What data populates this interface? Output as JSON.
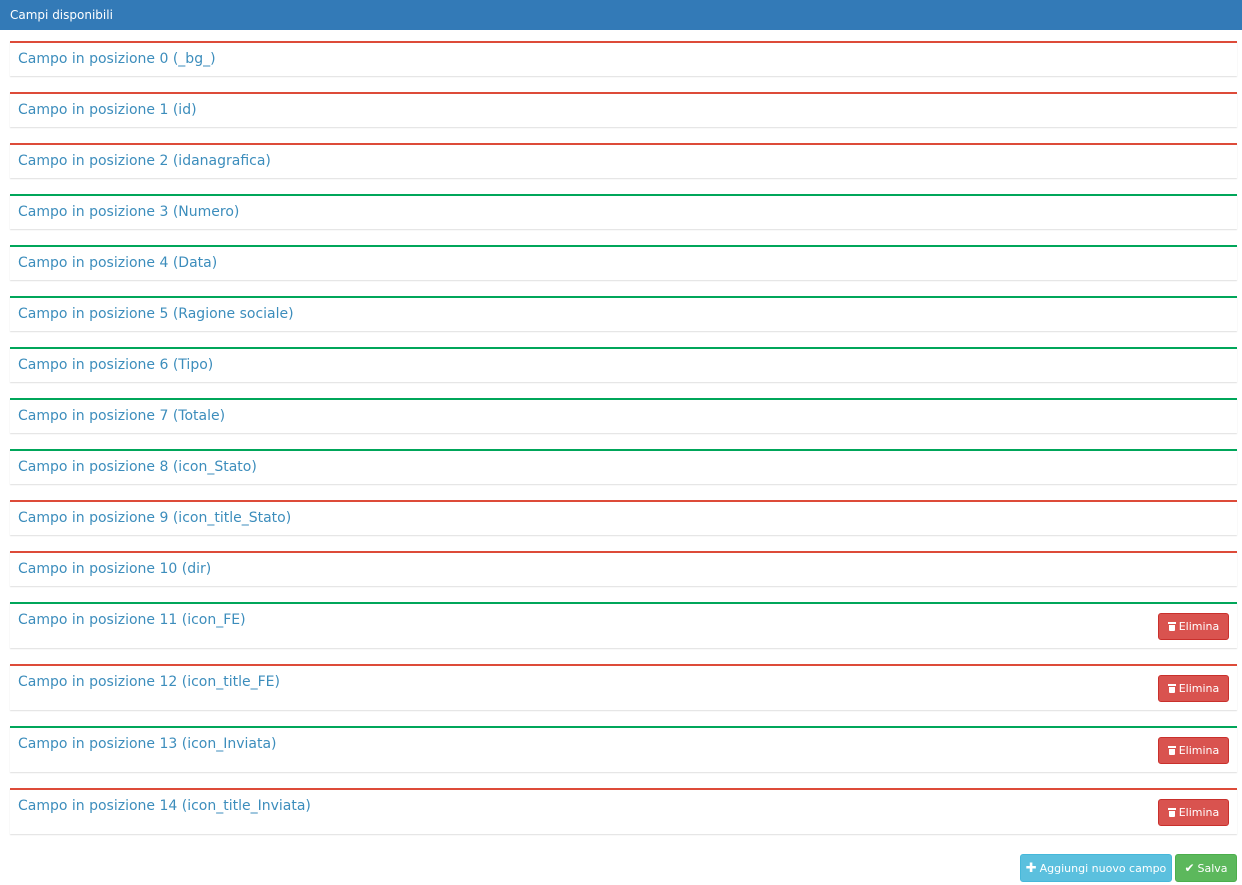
{
  "header": {
    "title": "Campi disponibili"
  },
  "fields": [
    {
      "label": "Campo in posizione 0 (_bg_)",
      "status": "red",
      "deletable": false
    },
    {
      "label": "Campo in posizione 1 (id)",
      "status": "red",
      "deletable": false
    },
    {
      "label": "Campo in posizione 2 (idanagrafica)",
      "status": "red",
      "deletable": false
    },
    {
      "label": "Campo in posizione 3 (Numero)",
      "status": "green",
      "deletable": false
    },
    {
      "label": "Campo in posizione 4 (Data)",
      "status": "green",
      "deletable": false
    },
    {
      "label": "Campo in posizione 5 (Ragione sociale)",
      "status": "green",
      "deletable": false
    },
    {
      "label": "Campo in posizione 6 (Tipo)",
      "status": "green",
      "deletable": false
    },
    {
      "label": "Campo in posizione 7 (Totale)",
      "status": "green",
      "deletable": false
    },
    {
      "label": "Campo in posizione 8 (icon_Stato)",
      "status": "green",
      "deletable": false
    },
    {
      "label": "Campo in posizione 9 (icon_title_Stato)",
      "status": "red",
      "deletable": false
    },
    {
      "label": "Campo in posizione 10 (dir)",
      "status": "red",
      "deletable": false
    },
    {
      "label": "Campo in posizione 11 (icon_FE)",
      "status": "green",
      "deletable": true
    },
    {
      "label": "Campo in posizione 12 (icon_title_FE)",
      "status": "red",
      "deletable": true
    },
    {
      "label": "Campo in posizione 13 (icon_Inviata)",
      "status": "green",
      "deletable": true
    },
    {
      "label": "Campo in posizione 14 (icon_title_Inviata)",
      "status": "red",
      "deletable": true
    }
  ],
  "delete_label": "Elimina",
  "footer": {
    "add_label": "Aggiungi nuovo campo",
    "save_label": "Salva"
  },
  "colors": {
    "header_bg": "#337ab7",
    "red_border": "#dd4b39",
    "green_border": "#00a65a",
    "link_text": "#3c8dbc",
    "danger": "#d9534f",
    "info": "#5bc0de",
    "success": "#5cb85c"
  },
  "icons": {
    "delete": "trash-icon",
    "add": "plus-icon",
    "save": "check-icon"
  }
}
